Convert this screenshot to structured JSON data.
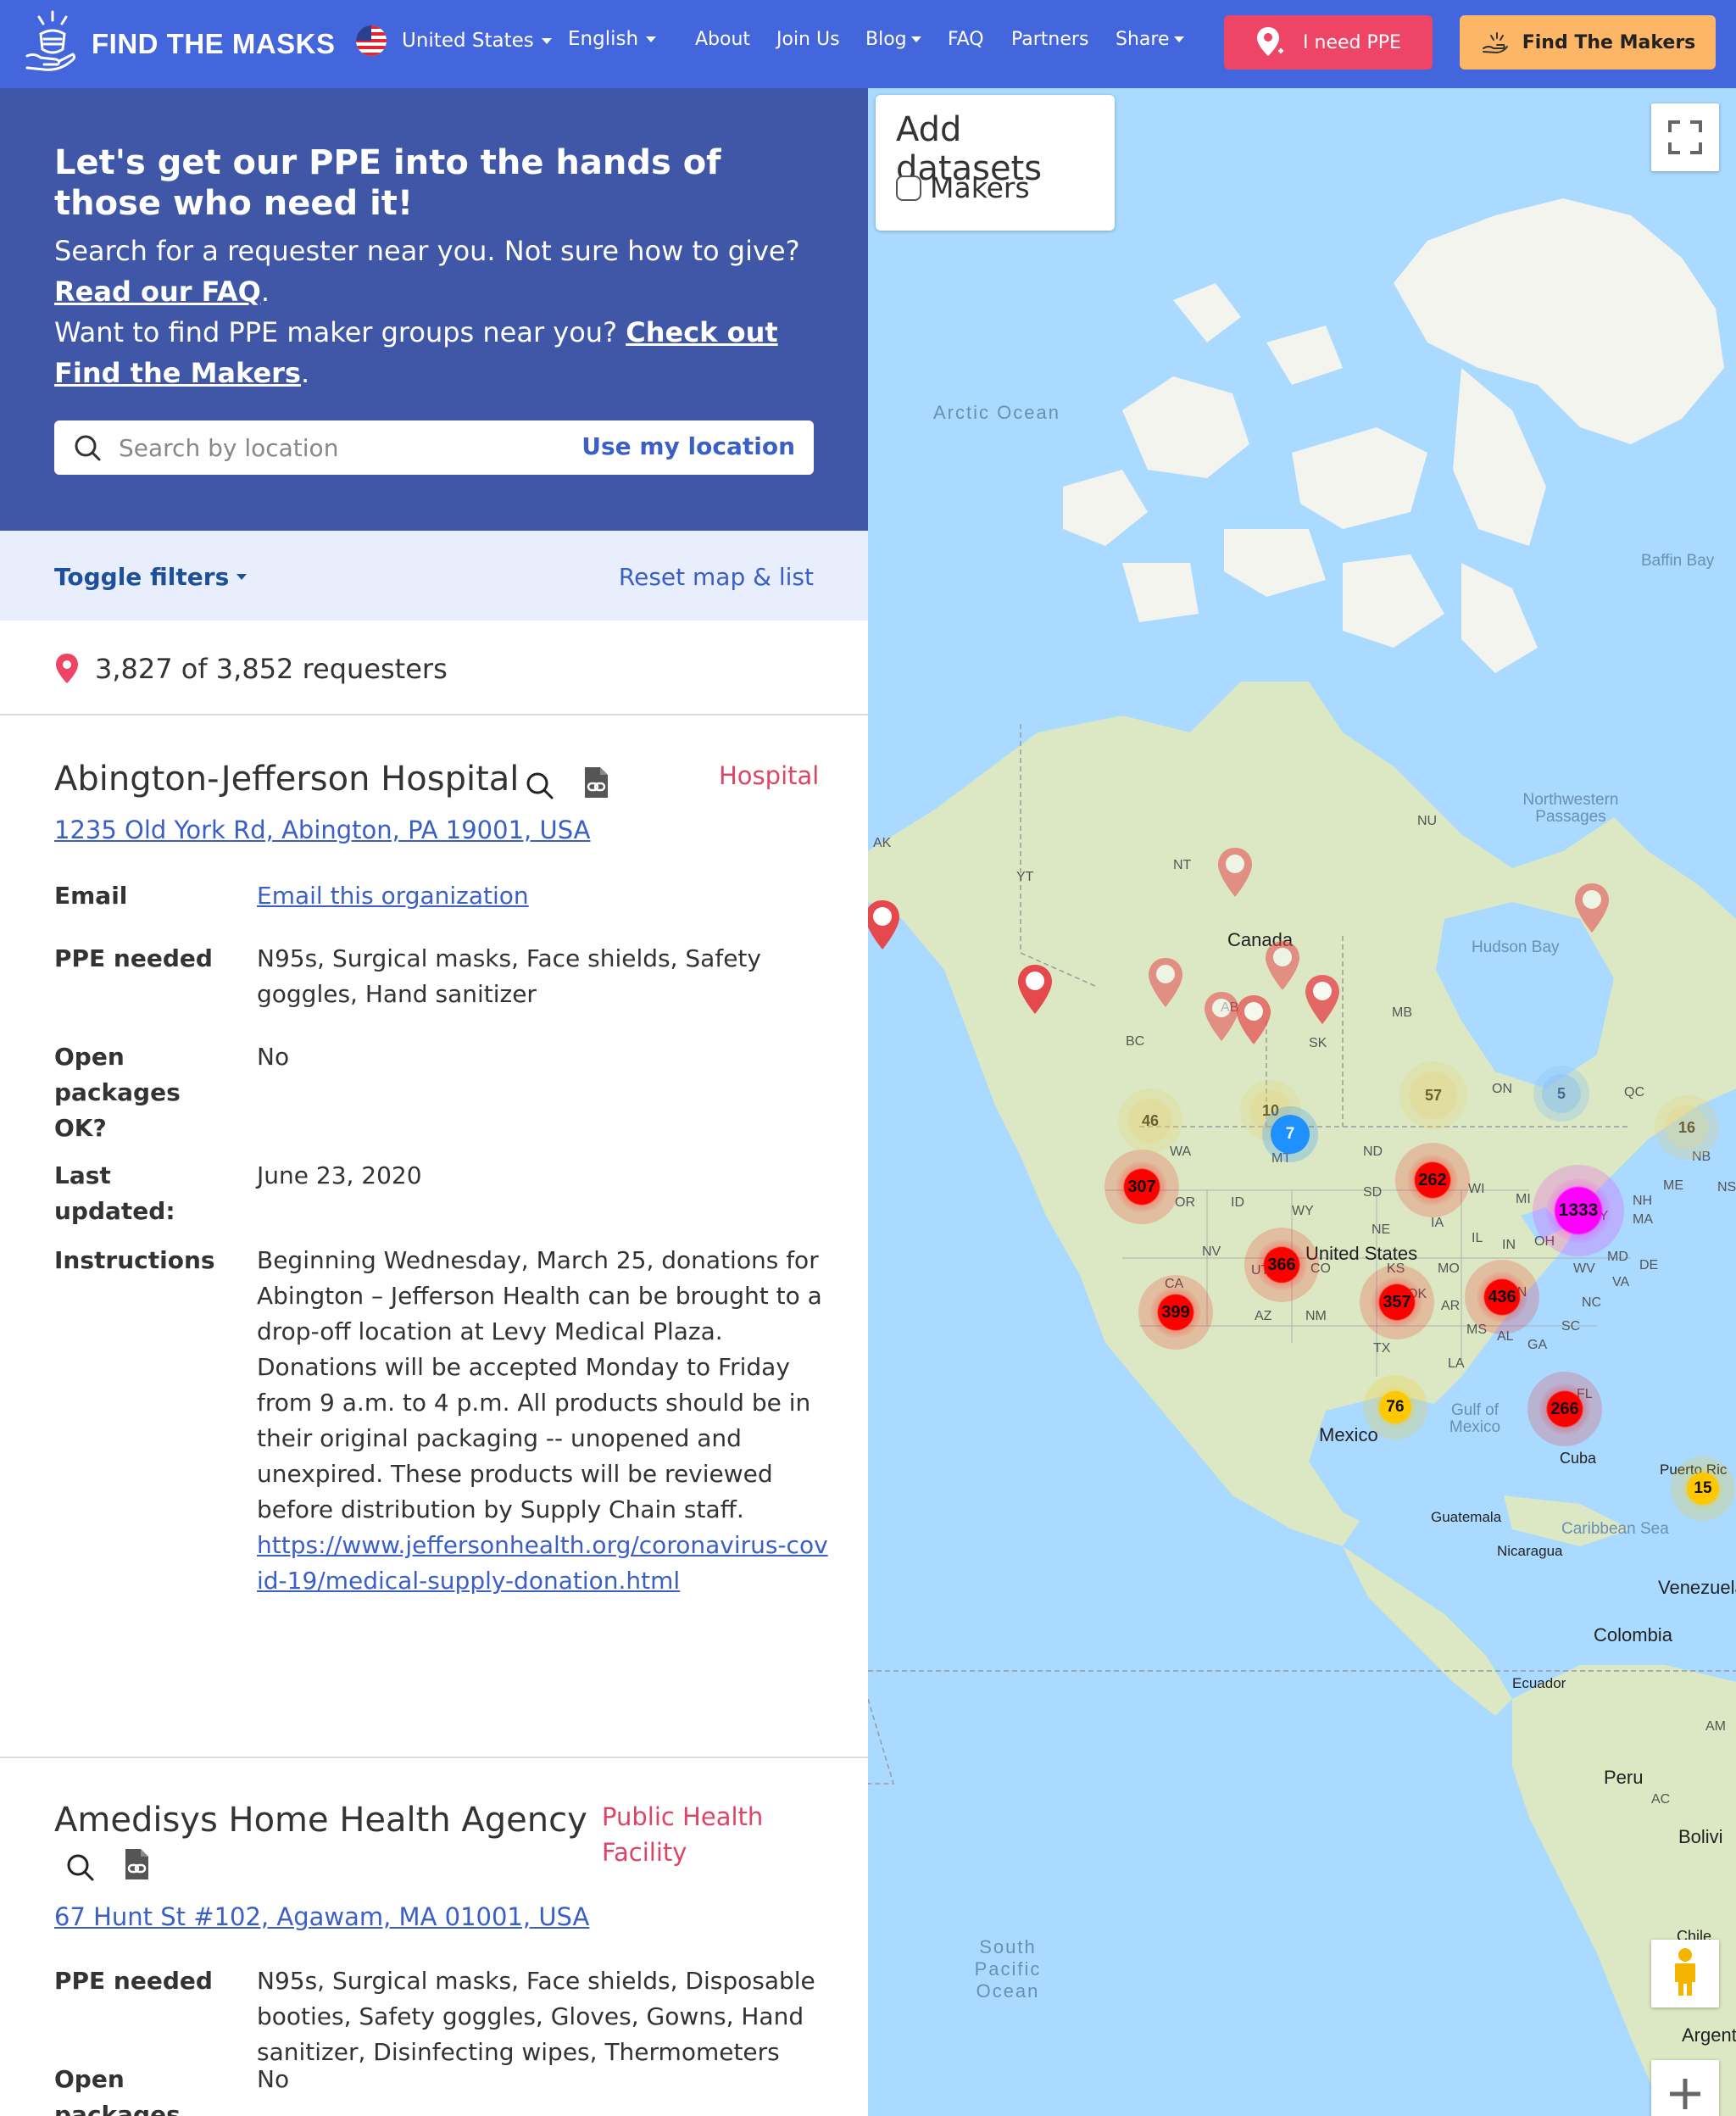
{
  "nav": {
    "brand": "FIND THE MASKS",
    "country": "United States",
    "language": "English",
    "links": [
      "About",
      "Join Us",
      "Blog",
      "FAQ",
      "Partners",
      "Share"
    ],
    "need_ppe": "I need PPE",
    "find_makers": "Find The Makers"
  },
  "hero": {
    "title": "Let's get our PPE into the hands of those who need it!",
    "line1": "Search for a requester near you. Not sure how to give?",
    "faq_link": "Read our FAQ",
    "line2": "Want to find PPE maker groups near you?",
    "makers_link": "Check out Find the Makers",
    "search_placeholder": "Search by location",
    "use_location": "Use my location"
  },
  "filters": {
    "toggle": "Toggle filters",
    "reset": "Reset map & list"
  },
  "count_text": "3,827 of 3,852 requesters",
  "cards": [
    {
      "name": "Abington-Jefferson Hospital",
      "type": "Hospital",
      "address": "1235 Old York Rd, Abington, PA 19001, USA",
      "email_label": "Email",
      "email_value": "Email this organization",
      "ppe_label": "PPE needed",
      "ppe_value": "N95s, Surgical masks, Face shields, Safety goggles, Hand sanitizer",
      "open_label": "Open packages OK?",
      "open_value": "No",
      "updated_label": "Last updated:",
      "updated_value": "June 23, 2020",
      "instructions_label": "Instructions",
      "instructions_value": "Beginning Wednesday, March 25, donations for Abington – Jefferson Health can be brought to a drop-off location at Levy Medical Plaza. Donations will be accepted Monday to Friday from 9 a.m. to 4 p.m. All products should be in their original packaging -- unopened and unexpired. These products will be reviewed before distribution by Supply Chain staff.",
      "instructions_link": "https://www.jeffersonhealth.org/coronavirus-covid-19/medical-supply-donation.html"
    },
    {
      "name": "Amedisys Home Health Agency",
      "type": "Public Health Facility",
      "address": "67 Hunt St #102, Agawam, MA 01001, USA",
      "ppe_label": "PPE needed",
      "ppe_value": "N95s, Surgical masks, Face shields, Disposable booties, Safety goggles, Gloves, Gowns, Hand sanitizer, Disinfecting wipes, Thermometers",
      "open_label": "Open packages OK?",
      "open_value": "No"
    }
  ],
  "map": {
    "datasets_title": "Add datasets",
    "makers_label": "Makers",
    "labels": {
      "arctic_ocean": "Arctic Ocean",
      "baffin_bay": "Baffin Bay",
      "northwestern_passages": "Northwestern Passages",
      "hudson_bay": "Hudson Bay",
      "canada": "Canada",
      "united_states": "United States",
      "mexico": "Mexico",
      "gulf_of_mexico": "Gulf of Mexico",
      "cuba": "Cuba",
      "guatemala": "Guatemala",
      "nicaragua": "Nicaragua",
      "caribbean_sea": "Caribbean Sea",
      "venezuela": "Venezuela",
      "colombia": "Colombia",
      "ecuador": "Ecuador",
      "peru": "Peru",
      "bolivia": "Bolivi",
      "chile": "Chile",
      "argentina": "Argentin",
      "south_pacific_ocean": "South Pacific Ocean",
      "puerto_rico": "Puerto Ric"
    },
    "states": [
      "AK",
      "YT",
      "NT",
      "NU",
      "BC",
      "AB",
      "SK",
      "MB",
      "ON",
      "QC",
      "NB",
      "NS",
      "ME",
      "NH",
      "MA",
      "WA",
      "OR",
      "ID",
      "MT",
      "WY",
      "ND",
      "SD",
      "NE",
      "CA",
      "NV",
      "CO",
      "KS",
      "MO",
      "IA",
      "IL",
      "WI",
      "MI",
      "IN",
      "OH",
      "KY",
      "WV",
      "VA",
      "MD",
      "DE",
      "TN",
      "NC",
      "SC",
      "GA",
      "AL",
      "MS",
      "LA",
      "AR",
      "TX",
      "OK",
      "NM",
      "AZ",
      "UT",
      "FL",
      "AM",
      "AC"
    ],
    "clusters": [
      {
        "count": "307",
        "color": "#ff0000"
      },
      {
        "count": "399",
        "color": "#ff0000"
      },
      {
        "count": "366",
        "color": "#ff0000"
      },
      {
        "count": "357",
        "color": "#ff0000"
      },
      {
        "count": "436",
        "color": "#ff0000"
      },
      {
        "count": "262",
        "color": "#ff0000"
      },
      {
        "count": "266",
        "color": "#ff0000"
      },
      {
        "count": "1333",
        "color": "#ff00ff"
      },
      {
        "count": "76",
        "color": "#ffc800"
      },
      {
        "count": "15",
        "color": "#ffc800"
      },
      {
        "count": "57",
        "color": "#e8d070"
      },
      {
        "count": "46",
        "color": "#e8d070"
      },
      {
        "count": "16",
        "color": "#e8d070"
      },
      {
        "count": "10",
        "color": "#e8d070"
      },
      {
        "count": "7",
        "color": "#1e90ff"
      },
      {
        "count": "5",
        "color": "#8ec5ee"
      }
    ]
  },
  "colors": {
    "nav_bg": "#4466dd",
    "hero_bg": "#3f57a6",
    "need_ppe": "#ee4466",
    "find_makers": "#fdb666",
    "link": "#3a5fc7",
    "type_tag": "#dd4466"
  }
}
